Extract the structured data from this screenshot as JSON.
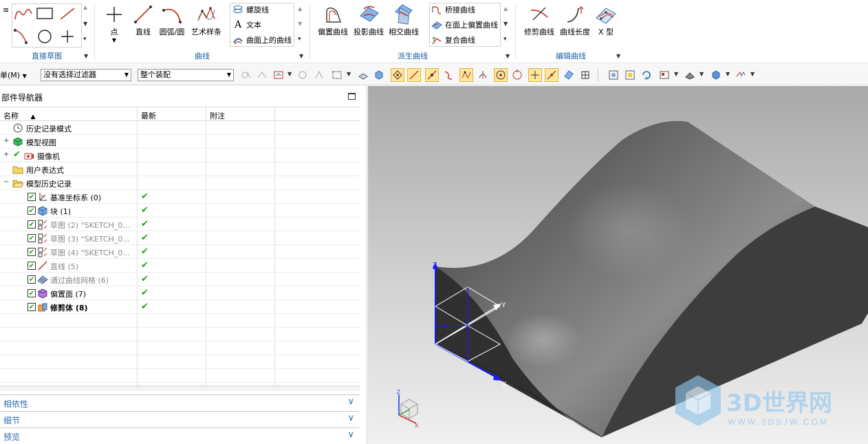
{
  "ribbon": {
    "groups": [
      {
        "label": "直接草图"
      },
      {
        "label": "曲线"
      },
      {
        "label": "派生曲线"
      },
      {
        "label": "编辑曲线"
      }
    ],
    "curve": {
      "point": "点",
      "line": "直线",
      "arc": "圆弧/圆",
      "spline": "艺术样条",
      "helix": "螺旋线",
      "text": "文本",
      "curve_on_surface": "曲面上的曲线"
    },
    "derived": {
      "offset": "偏置曲线",
      "project": "投影曲线",
      "intersect": "相交曲线",
      "bridge": "桥接曲线",
      "offset_in_face": "在面上偏置曲线",
      "composite": "复合曲线"
    },
    "edit": {
      "trim": "修剪曲线",
      "length": "曲线长度",
      "xshape": "X 型"
    }
  },
  "toolbar": {
    "menu_label": "单(M)",
    "filter": "没有选择过滤器",
    "scope": "整个装配"
  },
  "navigator": {
    "title": "部件导航器",
    "columns": {
      "name": "名称",
      "latest": "最新",
      "note": "附注"
    },
    "items": [
      {
        "label": "历史记录模式"
      },
      {
        "label": "模型视图"
      },
      {
        "label": "摄像机"
      },
      {
        "label": "用户表达式"
      },
      {
        "label": "模型历史记录"
      },
      {
        "label": "基准坐标系 (0)"
      },
      {
        "label": "块 (1)"
      },
      {
        "label": "草图 (2) \"SKETCH_0..."
      },
      {
        "label": "草图 (3) \"SKETCH_0..."
      },
      {
        "label": "草图 (4) \"SKETCH_0..."
      },
      {
        "label": "直线 (5)"
      },
      {
        "label": "通过曲线网格 (6)"
      },
      {
        "label": "偏置面 (7)"
      },
      {
        "label": "修剪体 (8)"
      }
    ],
    "panels": [
      "相依性",
      "细节",
      "预览"
    ]
  },
  "viewport": {
    "axes": {
      "x": "X",
      "y": "Y",
      "z": "Z"
    },
    "watermark": {
      "main": "3D世界网",
      "sub": "WWW.3DSJW.COM"
    }
  },
  "colors": {
    "accent": "#1e5fa6",
    "check_green": "#1ea21e",
    "active_btn": "#ffe69a"
  }
}
